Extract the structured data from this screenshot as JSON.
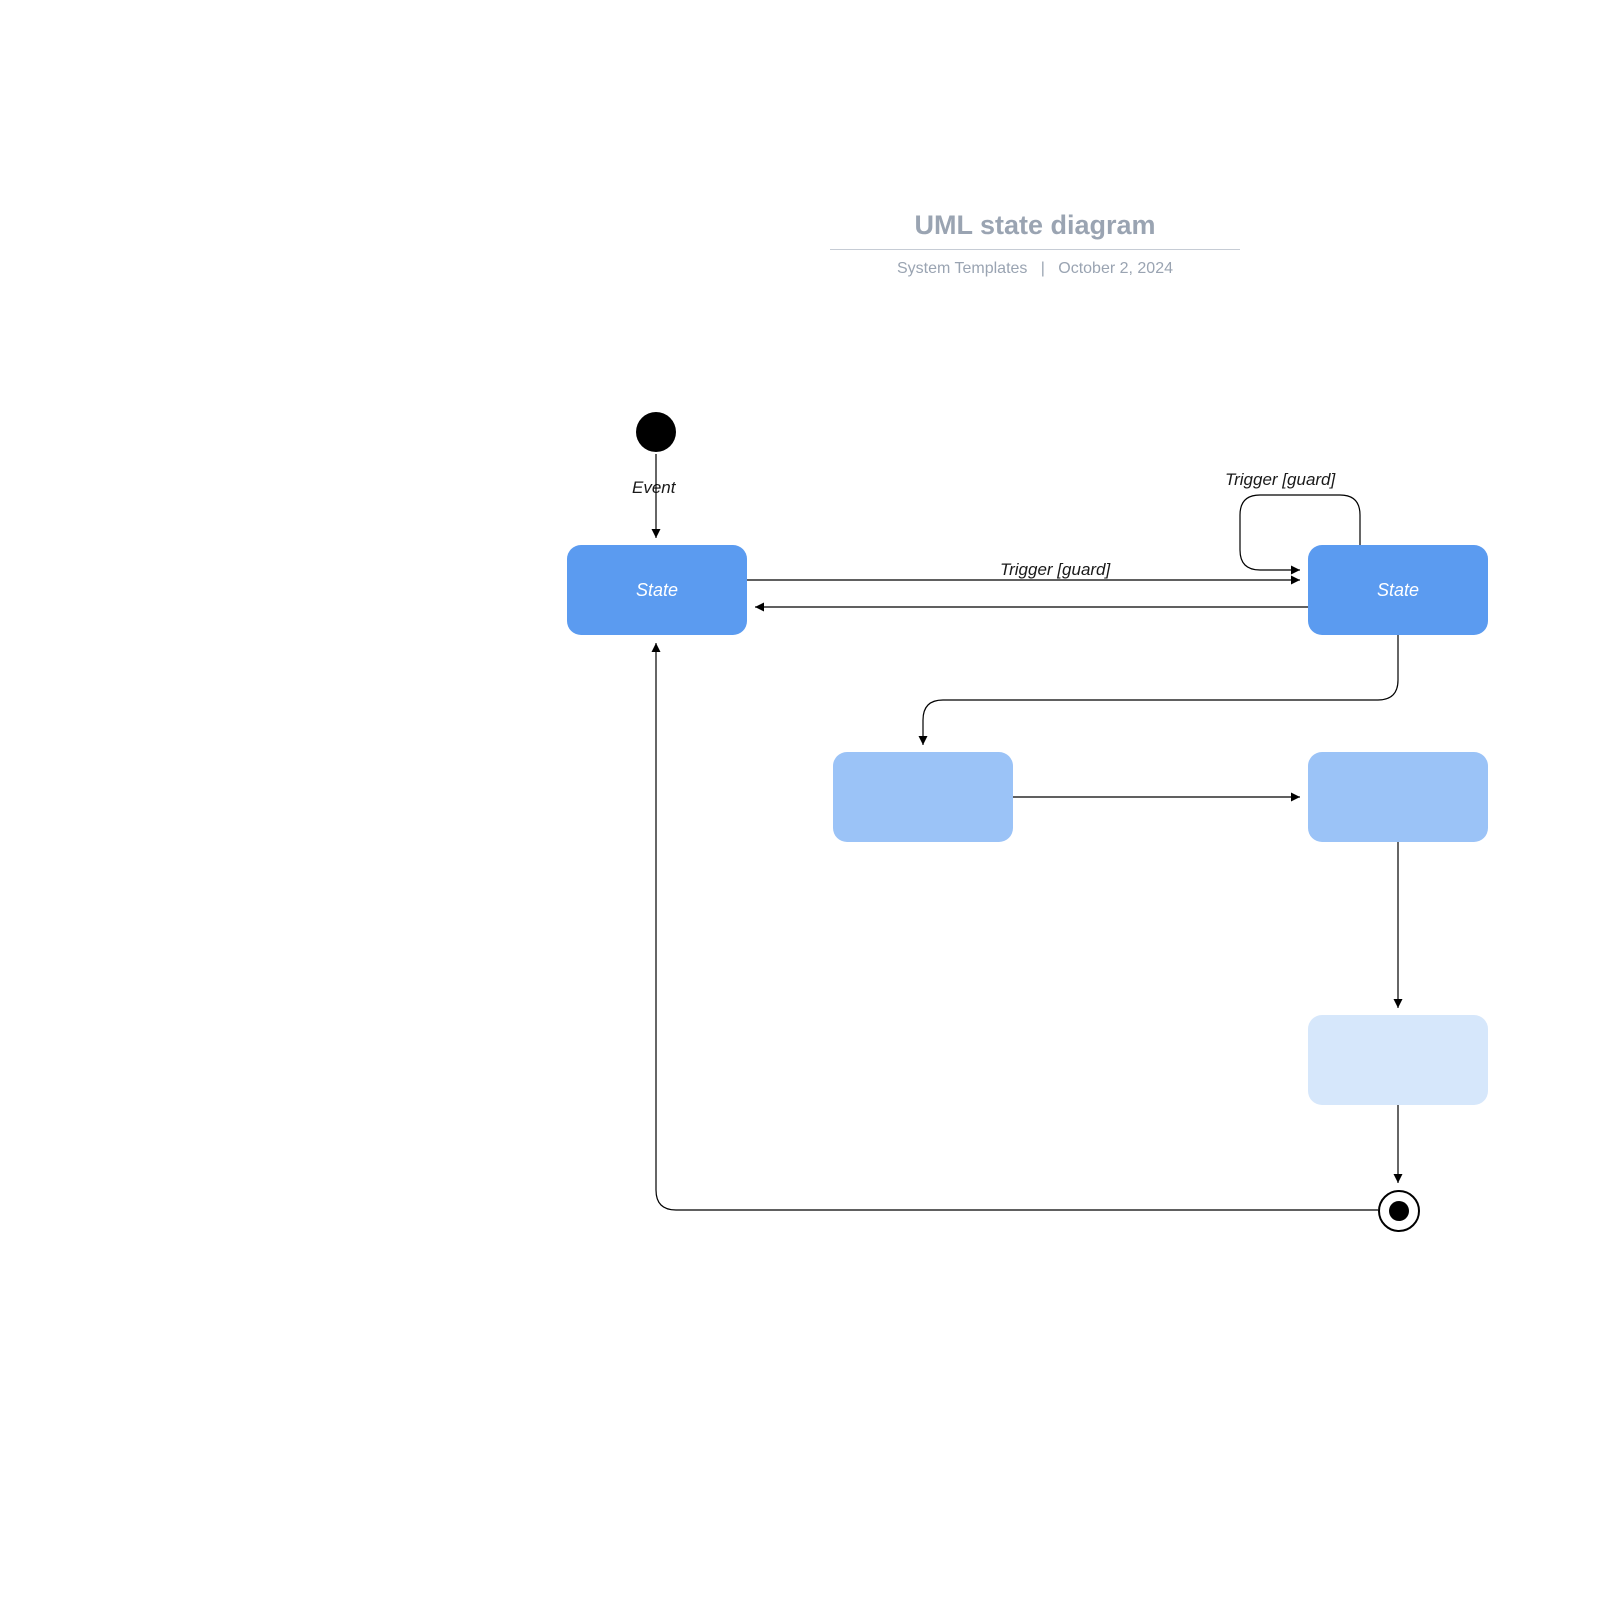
{
  "header": {
    "title": "UML state diagram",
    "subtitle_left": "System Templates",
    "subtitle_sep": "|",
    "subtitle_right": "October 2, 2024"
  },
  "labels": {
    "event": "Event",
    "trigger_top": "Trigger [guard]",
    "trigger_self": "Trigger [guard]"
  },
  "states": {
    "s1": "State",
    "s2": "State",
    "s3": "",
    "s4": "",
    "s5": ""
  },
  "colors": {
    "blue": "#5b9bf0",
    "light": "#9bc3f7",
    "lighter": "#d6e7fb",
    "title": "#9aa4b2"
  }
}
